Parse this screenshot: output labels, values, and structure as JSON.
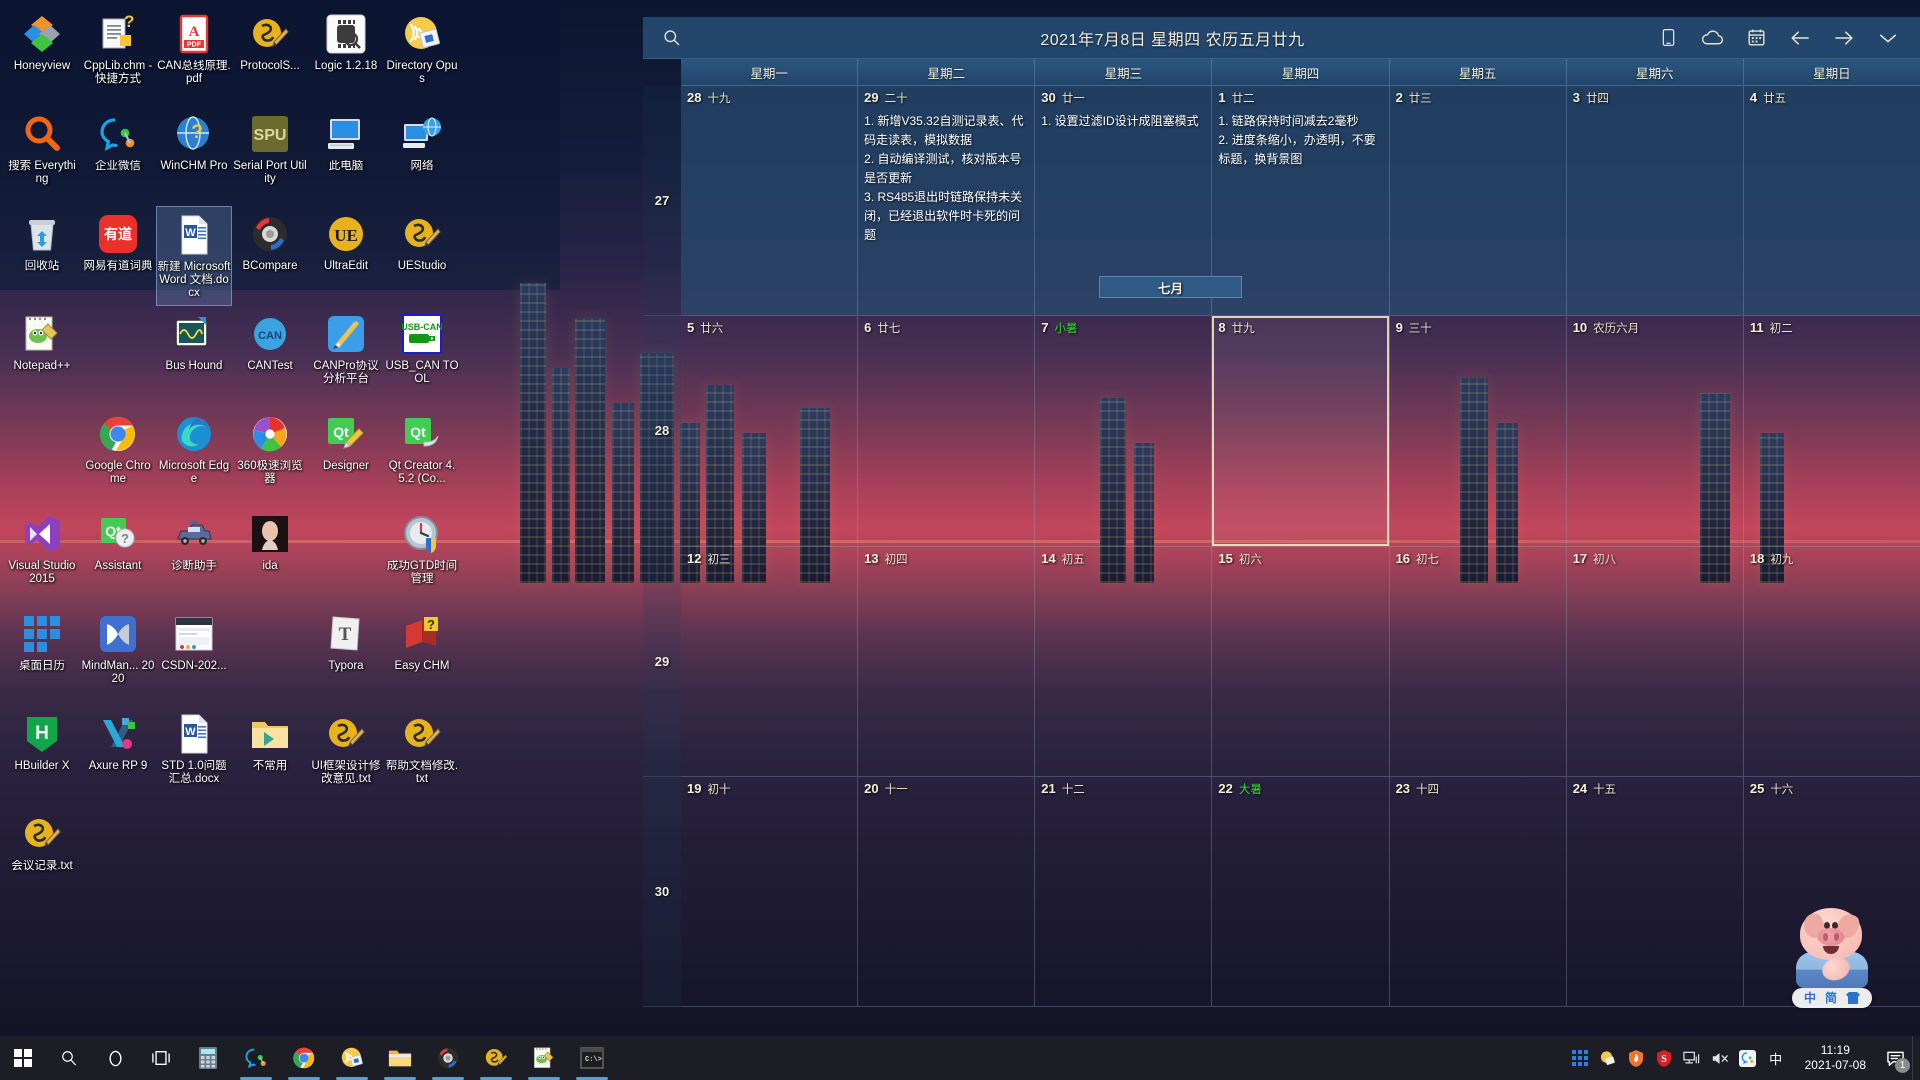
{
  "desktop": {
    "icons": [
      {
        "label": "Honeyview",
        "icon": "honeyview-icon",
        "selected": false
      },
      {
        "label": "CppLib.chm - 快捷方式",
        "icon": "chm-help-icon",
        "selected": false
      },
      {
        "label": "CAN总线原理.pdf",
        "icon": "pdf-icon",
        "selected": false
      },
      {
        "label": "ProtocolS...",
        "icon": "ultraedit-pen-icon",
        "selected": false
      },
      {
        "label": "Logic 1.2.18",
        "icon": "logic-analyzer-icon",
        "selected": false
      },
      {
        "label": "Directory Opus",
        "icon": "directory-opus-icon",
        "selected": false
      },
      {
        "label": "搜索 Everything",
        "icon": "magnifier-icon",
        "selected": false
      },
      {
        "label": "企业微信",
        "icon": "wecom-icon",
        "selected": false
      },
      {
        "label": "WinCHM Pro",
        "icon": "winchm-globe-icon",
        "selected": false
      },
      {
        "label": "Serial Port Utility",
        "icon": "spu-icon",
        "selected": false
      },
      {
        "label": "此电脑",
        "icon": "this-pc-icon",
        "selected": false
      },
      {
        "label": "网络",
        "icon": "network-icon",
        "selected": false
      },
      {
        "label": "回收站",
        "icon": "recycle-bin-icon",
        "selected": false
      },
      {
        "label": "网易有道词典",
        "icon": "youdao-dict-icon",
        "selected": false
      },
      {
        "label": "新建 Microsoft Word 文档.docx",
        "icon": "word-doc-icon",
        "selected": true
      },
      {
        "label": "BCompare",
        "icon": "beyond-compare-icon",
        "selected": false
      },
      {
        "label": "UltraEdit",
        "icon": "ultraedit-icon",
        "selected": false
      },
      {
        "label": "UEStudio",
        "icon": "uestudio-icon",
        "selected": false
      },
      {
        "label": "Notepad++",
        "icon": "notepad-plus-plus-icon",
        "selected": false
      },
      {
        "label": "",
        "icon": "blank-icon",
        "selected": false
      },
      {
        "label": "Bus Hound",
        "icon": "bus-hound-icon",
        "selected": false
      },
      {
        "label": "CANTest",
        "icon": "cantest-icon",
        "selected": false
      },
      {
        "label": "CANPro协议分析平台",
        "icon": "canpro-icon",
        "selected": false
      },
      {
        "label": "USB_CAN TOOL",
        "icon": "usb-can-tool-icon",
        "selected": false
      },
      {
        "label": "",
        "icon": "blank-icon",
        "selected": false
      },
      {
        "label": "Google Chrome",
        "icon": "chrome-icon",
        "selected": false
      },
      {
        "label": "Microsoft Edge",
        "icon": "edge-icon",
        "selected": false
      },
      {
        "label": "360极速浏览器",
        "icon": "360-browser-icon",
        "selected": false
      },
      {
        "label": "Designer",
        "icon": "qt-designer-icon",
        "selected": false
      },
      {
        "label": "Qt Creator 4.5.2 (Co...",
        "icon": "qt-creator-icon",
        "selected": false
      },
      {
        "label": "Visual Studio 2015",
        "icon": "visual-studio-icon",
        "selected": false
      },
      {
        "label": "Assistant",
        "icon": "qt-assistant-icon",
        "selected": false
      },
      {
        "label": "诊断助手",
        "icon": "diagnostic-car-icon",
        "selected": false
      },
      {
        "label": "ida",
        "icon": "ida-portrait-icon",
        "selected": false
      },
      {
        "label": "",
        "icon": "blank-icon",
        "selected": false
      },
      {
        "label": "成功GTD时间管理",
        "icon": "gtd-clock-icon",
        "selected": false
      },
      {
        "label": "桌面日历",
        "icon": "desktop-calendar-icon",
        "selected": false
      },
      {
        "label": "MindMan... 2020",
        "icon": "mindmanager-icon",
        "selected": false
      },
      {
        "label": "CSDN-202...",
        "icon": "csdn-screenshot-icon",
        "selected": false
      },
      {
        "label": "",
        "icon": "blank-icon",
        "selected": false
      },
      {
        "label": "Typora",
        "icon": "typora-icon",
        "selected": false
      },
      {
        "label": "Easy CHM",
        "icon": "easy-chm-icon",
        "selected": false
      },
      {
        "label": "HBuilder X",
        "icon": "hbuilder-x-icon",
        "selected": false
      },
      {
        "label": "Axure RP 9",
        "icon": "axure-icon",
        "selected": false
      },
      {
        "label": "STD 1.0问题汇总.docx",
        "icon": "word-doc-icon",
        "selected": false
      },
      {
        "label": "不常用",
        "icon": "folder-icon",
        "selected": false
      },
      {
        "label": "UI框架设计修改意见.txt",
        "icon": "uestudio-icon",
        "selected": false
      },
      {
        "label": "帮助文档修改.txt",
        "icon": "uestudio-icon",
        "selected": false
      },
      {
        "label": "会议记录.txt",
        "icon": "uestudio-icon",
        "selected": false
      }
    ]
  },
  "calendar": {
    "title": "2021年7月8日 星期四 农历五月廿九",
    "search_icon": "search-icon",
    "tools": [
      {
        "name": "phone-icon",
        "label": "手机"
      },
      {
        "name": "cloud-icon",
        "label": "云同步"
      },
      {
        "name": "calendar-icon",
        "label": "日历"
      },
      {
        "name": "back-arrow-icon",
        "label": "上一月"
      },
      {
        "name": "forward-arrow-icon",
        "label": "下一月"
      },
      {
        "name": "chevron-down-icon",
        "label": "更多"
      }
    ],
    "weekdays": [
      "星期一",
      "星期二",
      "星期三",
      "星期四",
      "星期五",
      "星期六",
      "星期日"
    ],
    "month_banner": "七月",
    "week_numbers": [
      "27",
      "28",
      "29",
      "30"
    ],
    "rows": [
      {
        "prev_month": true,
        "days": [
          {
            "num": "28",
            "lunar": "十九",
            "term": false,
            "today": false,
            "events": []
          },
          {
            "num": "29",
            "lunar": "二十",
            "term": false,
            "today": false,
            "events": [
              "1. 新增V35.32自测记录表、代码走读表，模拟数据",
              "2. 自动编译测试，核对版本号是否更新",
              "3. RS485退出时链路保持未关闭，已经退出软件时卡死的问题"
            ]
          },
          {
            "num": "30",
            "lunar": "廿一",
            "term": false,
            "today": false,
            "events": [
              "1. 设置过滤ID设计成阻塞模式"
            ]
          },
          {
            "num": "1",
            "lunar": "廿二",
            "term": false,
            "today": false,
            "events": [
              "1. 链路保持时间减去2毫秒",
              "2. 进度条缩小，办透明，不要标题，换背景图"
            ]
          },
          {
            "num": "2",
            "lunar": "廿三",
            "term": false,
            "today": false,
            "events": []
          },
          {
            "num": "3",
            "lunar": "廿四",
            "term": false,
            "today": false,
            "events": []
          },
          {
            "num": "4",
            "lunar": "廿五",
            "term": false,
            "today": false,
            "events": []
          }
        ]
      },
      {
        "prev_month": false,
        "days": [
          {
            "num": "5",
            "lunar": "廿六",
            "term": false,
            "today": false,
            "events": []
          },
          {
            "num": "6",
            "lunar": "廿七",
            "term": false,
            "today": false,
            "events": []
          },
          {
            "num": "7",
            "lunar": "小暑",
            "term": true,
            "today": false,
            "events": []
          },
          {
            "num": "8",
            "lunar": "廿九",
            "term": false,
            "today": true,
            "events": []
          },
          {
            "num": "9",
            "lunar": "三十",
            "term": false,
            "today": false,
            "events": []
          },
          {
            "num": "10",
            "lunar": "农历六月",
            "term": false,
            "today": false,
            "events": []
          },
          {
            "num": "11",
            "lunar": "初二",
            "term": false,
            "today": false,
            "events": []
          }
        ]
      },
      {
        "prev_month": false,
        "days": [
          {
            "num": "12",
            "lunar": "初三",
            "term": false,
            "today": false,
            "events": []
          },
          {
            "num": "13",
            "lunar": "初四",
            "term": false,
            "today": false,
            "events": []
          },
          {
            "num": "14",
            "lunar": "初五",
            "term": false,
            "today": false,
            "events": []
          },
          {
            "num": "15",
            "lunar": "初六",
            "term": false,
            "today": false,
            "events": []
          },
          {
            "num": "16",
            "lunar": "初七",
            "term": false,
            "today": false,
            "events": []
          },
          {
            "num": "17",
            "lunar": "初八",
            "term": false,
            "today": false,
            "events": []
          },
          {
            "num": "18",
            "lunar": "初九",
            "term": false,
            "today": false,
            "events": []
          }
        ]
      },
      {
        "prev_month": false,
        "days": [
          {
            "num": "19",
            "lunar": "初十",
            "term": false,
            "today": false,
            "events": []
          },
          {
            "num": "20",
            "lunar": "十一",
            "term": false,
            "today": false,
            "events": []
          },
          {
            "num": "21",
            "lunar": "十二",
            "term": false,
            "today": false,
            "events": []
          },
          {
            "num": "22",
            "lunar": "大暑",
            "term": true,
            "today": false,
            "events": []
          },
          {
            "num": "23",
            "lunar": "十四",
            "term": false,
            "today": false,
            "events": []
          },
          {
            "num": "24",
            "lunar": "十五",
            "term": false,
            "today": false,
            "events": []
          },
          {
            "num": "25",
            "lunar": "十六",
            "term": false,
            "today": false,
            "events": []
          }
        ]
      }
    ]
  },
  "pig_widget": {
    "name": "pig-mascot",
    "bar_items": [
      "中",
      "简",
      "shirt-icon"
    ]
  },
  "taskbar": {
    "start": {
      "name": "start-button",
      "label": "开始"
    },
    "search": {
      "name": "taskbar-search-icon",
      "label": "搜索"
    },
    "cortana": {
      "name": "cortana-icon",
      "label": "Cortana"
    },
    "taskview": {
      "name": "task-view-icon",
      "label": "任务视图"
    },
    "apps": [
      {
        "name": "calculator-icon",
        "label": "计算器",
        "running": false
      },
      {
        "name": "wecom-icon",
        "label": "企业微信",
        "running": true
      },
      {
        "name": "chrome-icon",
        "label": "Google Chrome",
        "running": true
      },
      {
        "name": "directory-opus-icon",
        "label": "Directory Opus",
        "running": true
      },
      {
        "name": "file-explorer-icon",
        "label": "文件资源管理器",
        "running": true
      },
      {
        "name": "beyond-compare-icon",
        "label": "BCompare",
        "running": true
      },
      {
        "name": "uestudio-icon",
        "label": "UEStudio",
        "running": true
      },
      {
        "name": "notepad-plus-plus-icon",
        "label": "Notepad++",
        "running": true
      },
      {
        "name": "console-icon",
        "label": "命令提示符",
        "running": true
      }
    ],
    "tray": [
      {
        "name": "tray-grid-icon",
        "label": "显示隐藏的图标"
      },
      {
        "name": "tray-opus-icon",
        "label": "Directory Opus"
      },
      {
        "name": "tray-shield-icon",
        "label": "安全卫士"
      },
      {
        "name": "tray-360-icon",
        "label": "360"
      },
      {
        "name": "tray-network-icon",
        "label": "网络"
      },
      {
        "name": "tray-volume-muted-icon",
        "label": "音量 静音"
      },
      {
        "name": "tray-wecom-icon",
        "label": "企业微信"
      },
      {
        "name": "tray-ime-icon",
        "label": "中"
      }
    ],
    "clock": {
      "time": "11:19",
      "date": "2021-07-08"
    },
    "notification": {
      "name": "notification-center-icon",
      "count": "1"
    }
  }
}
